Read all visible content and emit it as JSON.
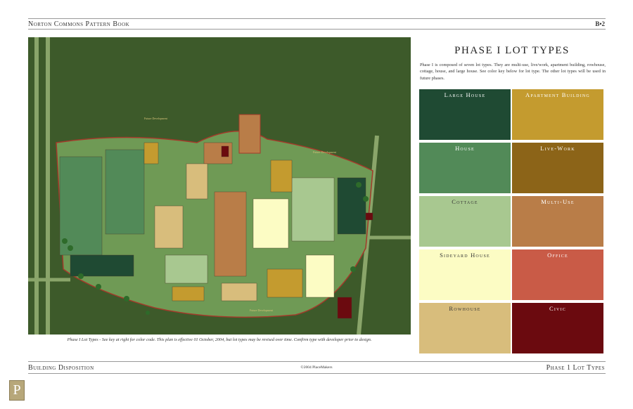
{
  "header": {
    "book_title": "Norton Commons Pattern Book",
    "page_number": "B•2"
  },
  "map": {
    "caption": "Phase I Lot Types - See key at right for color code. This plan is effective 01 October, 2004, but lot types may be revised over time. Confirm type with developer prior to design.",
    "labels": [
      "Future Development",
      "Future Development",
      "Future Development"
    ]
  },
  "panel": {
    "title": "PHASE I LOT TYPES",
    "description": "Phase I is composed of seven lot types. They are multi-use, live/work, apartment building, rowhouse, cottage, house, and large house. See color key below for lot type. The other lot types will be used in future phases."
  },
  "legend": [
    {
      "label": "Large House",
      "color": "#1f4a33",
      "text_color": "#ffffff"
    },
    {
      "label": "Apartment Building",
      "color": "#c49b2f",
      "text_color": "#ffffff"
    },
    {
      "label": "House",
      "color": "#528a58",
      "text_color": "#ffffff"
    },
    {
      "label": "Live-Work",
      "color": "#8c6418",
      "text_color": "#ffffff"
    },
    {
      "label": "Cottage",
      "color": "#a8c890",
      "text_color": "#333333"
    },
    {
      "label": "Multi-Use",
      "color": "#b97d48",
      "text_color": "#ffffff"
    },
    {
      "label": "Sideyard House",
      "color": "#fcfcc4",
      "text_color": "#333333"
    },
    {
      "label": "Office",
      "color": "#c95b47",
      "text_color": "#ffffff"
    },
    {
      "label": "Rowhouse",
      "color": "#d8bd7c",
      "text_color": "#333333"
    },
    {
      "label": "Civic",
      "color": "#6b0a0f",
      "text_color": "#ffffff"
    }
  ],
  "footer": {
    "section": "Building Disposition",
    "copyright": "©2004 PlaceMakers",
    "topic": "Phase 1 Lot Types",
    "logo_letter": "P"
  }
}
